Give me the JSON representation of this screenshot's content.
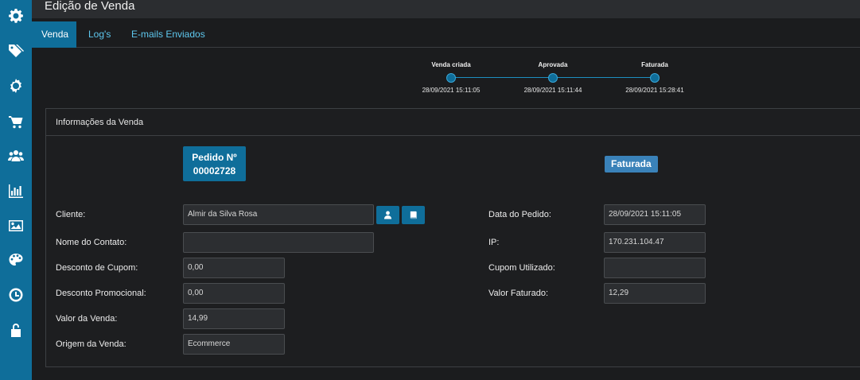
{
  "sidebar": {
    "icons": [
      "gear-icon",
      "tags-icon",
      "cog-icon",
      "cart-icon",
      "users-icon",
      "bar-chart-icon",
      "image-icon",
      "palette-icon",
      "clock-icon",
      "unlock-icon"
    ]
  },
  "header": {
    "title": "Edição de Venda"
  },
  "tabs": [
    {
      "label": "Venda",
      "active": true
    },
    {
      "label": "Log's",
      "active": false
    },
    {
      "label": "E-mails Enviados",
      "active": false
    }
  ],
  "timeline": [
    {
      "label": "Venda criada",
      "date": "28/09/2021 15:11:05"
    },
    {
      "label": "Aprovada",
      "date": "28/09/2021 15:11:44"
    },
    {
      "label": "Faturada",
      "date": "28/09/2021 15:28:41"
    }
  ],
  "panel": {
    "title": "Informações da Venda",
    "order_label": "Pedido Nº",
    "order_number": "00002728",
    "status": "Faturada"
  },
  "form_left": {
    "cliente": {
      "label": "Cliente:",
      "value": "Almir da Silva Rosa"
    },
    "contato": {
      "label": "Nome do Contato:",
      "value": ""
    },
    "cupom": {
      "label": "Desconto de Cupom:",
      "value": "0,00"
    },
    "promocional": {
      "label": "Desconto Promocional:",
      "value": "0,00"
    },
    "valor": {
      "label": "Valor da Venda:",
      "value": "14,99"
    },
    "origem": {
      "label": "Origem da Venda:",
      "value": "Ecommerce"
    }
  },
  "form_right": {
    "data": {
      "label": "Data do Pedido:",
      "value": "28/09/2021 15:11:05"
    },
    "ip": {
      "label": "IP:",
      "value": "170.231.104.47"
    },
    "cupom_usado": {
      "label": "Cupom Utilizado:",
      "value": ""
    },
    "faturado": {
      "label": "Valor Faturado:",
      "value": "12,29"
    }
  },
  "colors": {
    "accent": "#0f6e9a",
    "status": "#3a82b9",
    "background": "#1b1c1e"
  }
}
